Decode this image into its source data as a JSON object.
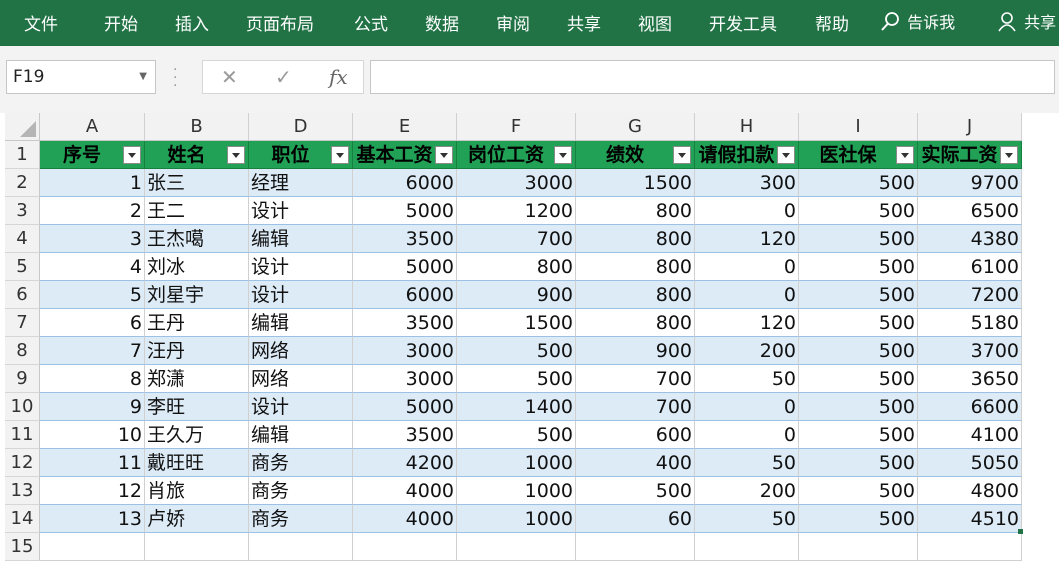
{
  "ribbon": {
    "tabs": [
      "文件",
      "开始",
      "插入",
      "页面布局",
      "公式",
      "数据",
      "审阅",
      "共享",
      "视图",
      "开发工具",
      "帮助"
    ],
    "search_label": "告诉我",
    "share_label": "共享"
  },
  "formula_bar": {
    "name_box": "F19",
    "cancel_symbol": "✕",
    "enter_symbol": "✓",
    "fx_label": "fx",
    "formula": ""
  },
  "columns": [
    "A",
    "B",
    "D",
    "E",
    "F",
    "G",
    "H",
    "I",
    "J"
  ],
  "row_numbers": [
    "1",
    "2",
    "3",
    "4",
    "5",
    "6",
    "7",
    "8",
    "9",
    "10",
    "11",
    "12",
    "13",
    "14",
    "15"
  ],
  "table": {
    "headers": [
      "序号",
      "姓名",
      "职位",
      "基本工资",
      "岗位工资",
      "绩效",
      "请假扣款",
      "医社保",
      "实际工资"
    ],
    "rows": [
      [
        "1",
        "张三",
        "经理",
        "6000",
        "3000",
        "1500",
        "300",
        "500",
        "9700"
      ],
      [
        "2",
        "王二",
        "设计",
        "5000",
        "1200",
        "800",
        "0",
        "500",
        "6500"
      ],
      [
        "3",
        "王杰噶",
        "编辑",
        "3500",
        "700",
        "800",
        "120",
        "500",
        "4380"
      ],
      [
        "4",
        "刘冰",
        "设计",
        "5000",
        "800",
        "800",
        "0",
        "500",
        "6100"
      ],
      [
        "5",
        "刘星宇",
        "设计",
        "6000",
        "900",
        "800",
        "0",
        "500",
        "7200"
      ],
      [
        "6",
        "王丹",
        "编辑",
        "3500",
        "1500",
        "800",
        "120",
        "500",
        "5180"
      ],
      [
        "7",
        "汪丹",
        "网络",
        "3000",
        "500",
        "900",
        "200",
        "500",
        "3700"
      ],
      [
        "8",
        "郑潇",
        "网络",
        "3000",
        "500",
        "700",
        "50",
        "500",
        "3650"
      ],
      [
        "9",
        "李旺",
        "设计",
        "5000",
        "1400",
        "700",
        "0",
        "500",
        "6600"
      ],
      [
        "10",
        "王久万",
        "编辑",
        "3500",
        "500",
        "600",
        "0",
        "500",
        "4100"
      ],
      [
        "11",
        "戴旺旺",
        "商务",
        "4200",
        "1000",
        "400",
        "50",
        "500",
        "5050"
      ],
      [
        "12",
        "肖旅",
        "商务",
        "4000",
        "1000",
        "500",
        "200",
        "500",
        "4800"
      ],
      [
        "13",
        "卢娇",
        "商务",
        "4000",
        "1000",
        "60",
        "50",
        "500",
        "4510"
      ]
    ]
  },
  "colors": {
    "ribbon": "#217346",
    "header_fill": "#21a155",
    "band_fill": "#ddebf7"
  }
}
